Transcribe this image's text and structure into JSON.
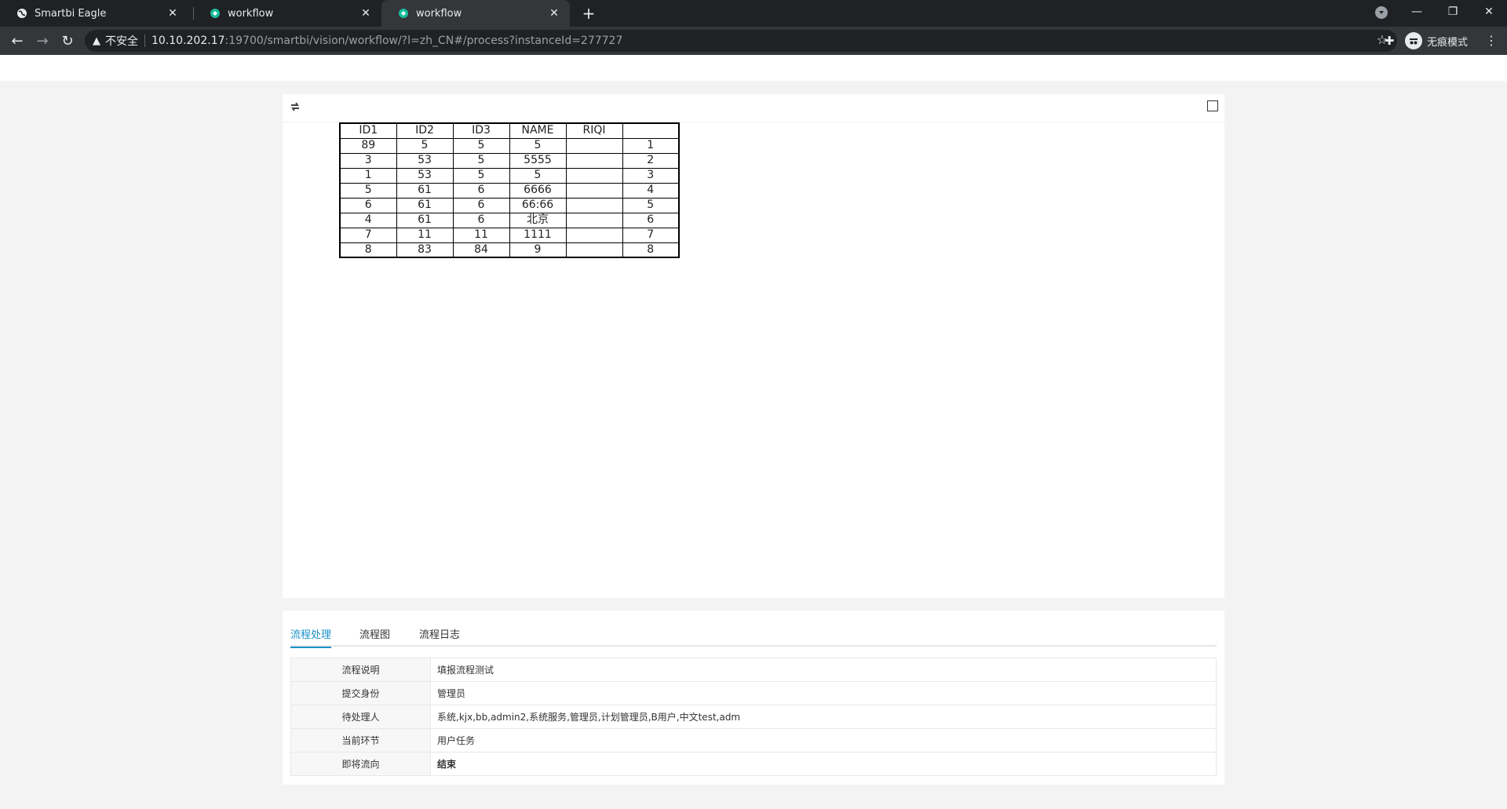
{
  "browser": {
    "tabs": [
      {
        "title": "Smartbi Eagle",
        "active": false
      },
      {
        "title": "workflow",
        "active": false
      },
      {
        "title": "workflow",
        "active": true
      }
    ],
    "address": {
      "security_label": "不安全",
      "host": "10.10.202.17",
      "path": ":19700/smartbi/vision/workflow/?l=zh_CN#/process?instanceId=277727"
    },
    "incognito_label": "无痕模式"
  },
  "report": {
    "headers": [
      "ID1",
      "ID2",
      "ID3",
      "NAME",
      "RIQI",
      ""
    ],
    "rows": [
      [
        "89",
        "5",
        "5",
        "5",
        "",
        "1"
      ],
      [
        "3",
        "53",
        "5",
        "5555",
        "",
        "2"
      ],
      [
        "1",
        "53",
        "5",
        "5",
        "",
        "3"
      ],
      [
        "5",
        "61",
        "6",
        "6666",
        "",
        "4"
      ],
      [
        "6",
        "61",
        "6",
        "66:66",
        "",
        "5"
      ],
      [
        "4",
        "61",
        "6",
        "北京",
        "",
        "6"
      ],
      [
        "7",
        "11",
        "11",
        "1111",
        "",
        "7"
      ],
      [
        "8",
        "83",
        "84",
        "9",
        "",
        "8"
      ]
    ]
  },
  "process": {
    "tabs": [
      "流程处理",
      "流程图",
      "流程日志"
    ],
    "active_tab": "流程处理",
    "accent_color": "#1890c8",
    "fields": [
      {
        "label": "流程说明",
        "value": "填报流程测试"
      },
      {
        "label": "提交身份",
        "value": "管理员"
      },
      {
        "label": "待处理人",
        "value": "系统,kjx,bb,admin2,系统服务,管理员,计划管理员,B用户,中文test,adm"
      },
      {
        "label": "当前环节",
        "value": "用户任务"
      },
      {
        "label": "即将流向",
        "value": "结束"
      }
    ]
  }
}
